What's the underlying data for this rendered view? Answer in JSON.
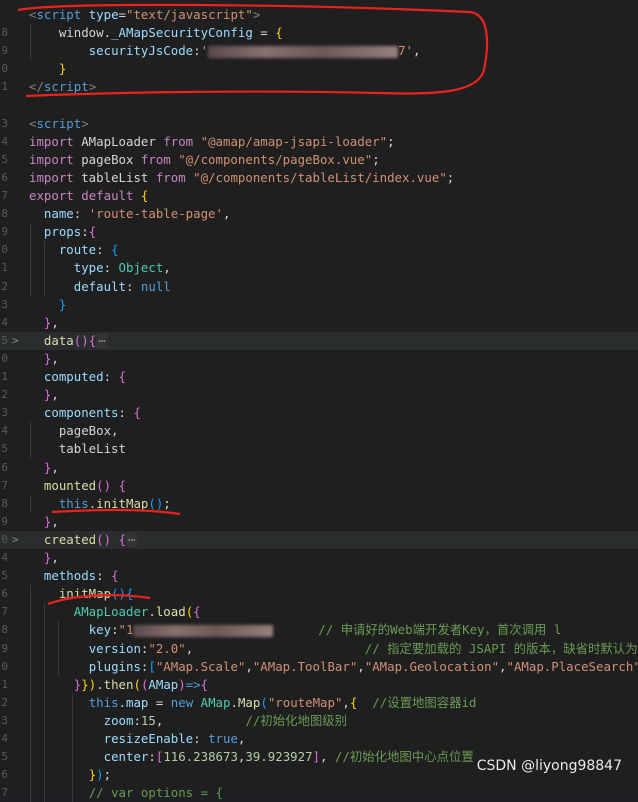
{
  "editor": {
    "language": "vue",
    "lines": [
      {
        "num": "",
        "fold": "",
        "segments": [
          [
            "tag",
            "<"
          ],
          [
            "tagname",
            "script"
          ],
          [
            "attr",
            " type"
          ],
          [
            "plain",
            "="
          ],
          [
            "str",
            "\"text/javascript\""
          ],
          [
            "tag",
            ">"
          ]
        ]
      },
      {
        "num": "8",
        "fold": "",
        "segments": [
          [
            "plain",
            "    window.",
            ""
          ],
          [
            "var",
            "_AMapSecurityConfig"
          ],
          [
            "plain",
            " = "
          ],
          [
            "brk",
            "{"
          ]
        ]
      },
      {
        "num": "9",
        "fold": "",
        "segments": [
          [
            "plain",
            "        "
          ],
          [
            "var",
            "securityJsCode"
          ],
          [
            "plain",
            ":"
          ],
          [
            "str",
            "'"
          ],
          [
            "blur",
            ""
          ],
          [
            "str",
            "7'"
          ],
          [
            "plain",
            ","
          ]
        ]
      },
      {
        "num": "0",
        "fold": "",
        "segments": [
          [
            "plain",
            "    "
          ],
          [
            "brk",
            "}"
          ]
        ]
      },
      {
        "num": "1",
        "fold": "",
        "segments": [
          [
            "tag",
            "</"
          ],
          [
            "tagname",
            "script"
          ],
          [
            "tag",
            ">"
          ]
        ]
      },
      {
        "num": "",
        "fold": "",
        "segments": []
      },
      {
        "num": "3",
        "fold": "",
        "segments": [
          [
            "tag",
            "<"
          ],
          [
            "tagname",
            "script"
          ],
          [
            "tag",
            ">"
          ]
        ]
      },
      {
        "num": "4",
        "fold": "",
        "segments": [
          [
            "kw2",
            "import"
          ],
          [
            "plain",
            " AMapLoader "
          ],
          [
            "kw2",
            "from"
          ],
          [
            "plain",
            " "
          ],
          [
            "str",
            "\"@amap/amap-jsapi-loader\""
          ],
          [
            "plain",
            ";"
          ]
        ]
      },
      {
        "num": "5",
        "fold": "",
        "segments": [
          [
            "kw2",
            "import"
          ],
          [
            "plain",
            " pageBox "
          ],
          [
            "kw2",
            "from"
          ],
          [
            "plain",
            " "
          ],
          [
            "str",
            "\"@/components/pageBox.vue\""
          ],
          [
            "plain",
            ";"
          ]
        ]
      },
      {
        "num": "6",
        "fold": "",
        "segments": [
          [
            "kw2",
            "import"
          ],
          [
            "plain",
            " tableList "
          ],
          [
            "kw2",
            "from"
          ],
          [
            "plain",
            " "
          ],
          [
            "str",
            "\"@/components/tableList/index.vue\""
          ],
          [
            "plain",
            ";"
          ]
        ]
      },
      {
        "num": "7",
        "fold": "",
        "segments": [
          [
            "kw2",
            "export"
          ],
          [
            "plain",
            " "
          ],
          [
            "kw2",
            "default"
          ],
          [
            "plain",
            " "
          ],
          [
            "brk",
            "{"
          ]
        ]
      },
      {
        "num": "8",
        "fold": "",
        "segments": [
          [
            "plain",
            "  "
          ],
          [
            "var",
            "name"
          ],
          [
            "plain",
            ": "
          ],
          [
            "str",
            "'route-table-page'"
          ],
          [
            "plain",
            ","
          ]
        ]
      },
      {
        "num": "9",
        "fold": "",
        "segments": [
          [
            "plain",
            "  "
          ],
          [
            "var",
            "props"
          ],
          [
            "plain",
            ":"
          ],
          [
            "brk2",
            "{"
          ]
        ]
      },
      {
        "num": "0",
        "fold": "",
        "segments": [
          [
            "plain",
            "    "
          ],
          [
            "var",
            "route"
          ],
          [
            "plain",
            ": "
          ],
          [
            "brk3",
            "{"
          ]
        ]
      },
      {
        "num": "1",
        "fold": "",
        "segments": [
          [
            "plain",
            "      "
          ],
          [
            "var",
            "type"
          ],
          [
            "plain",
            ": "
          ],
          [
            "cls",
            "Object"
          ],
          [
            "plain",
            ","
          ]
        ]
      },
      {
        "num": "2",
        "fold": "",
        "segments": [
          [
            "plain",
            "      "
          ],
          [
            "var",
            "default"
          ],
          [
            "plain",
            ": "
          ],
          [
            "kw",
            "null"
          ]
        ]
      },
      {
        "num": "3",
        "fold": "",
        "segments": [
          [
            "plain",
            "    "
          ],
          [
            "brk3",
            "}"
          ]
        ]
      },
      {
        "num": "4",
        "fold": "",
        "segments": [
          [
            "plain",
            "  "
          ],
          [
            "brk2",
            "}"
          ],
          [
            "plain",
            ","
          ]
        ]
      },
      {
        "num": "5",
        "fold": ">",
        "hl": true,
        "segments": [
          [
            "plain",
            "  "
          ],
          [
            "fn",
            "data"
          ],
          [
            "brk2",
            "()"
          ],
          [
            "brk2",
            "{"
          ],
          [
            "ellipsis",
            "⋯"
          ]
        ]
      },
      {
        "num": "0",
        "fold": "",
        "segments": [
          [
            "plain",
            "  "
          ],
          [
            "brk2",
            "}"
          ],
          [
            "plain",
            ","
          ]
        ]
      },
      {
        "num": "1",
        "fold": "",
        "segments": [
          [
            "plain",
            "  "
          ],
          [
            "var",
            "computed"
          ],
          [
            "plain",
            ": "
          ],
          [
            "brk2",
            "{"
          ]
        ]
      },
      {
        "num": "2",
        "fold": "",
        "segments": [
          [
            "plain",
            "  "
          ],
          [
            "brk2",
            "}"
          ],
          [
            "plain",
            ","
          ]
        ]
      },
      {
        "num": "3",
        "fold": "",
        "segments": [
          [
            "plain",
            "  "
          ],
          [
            "var",
            "components"
          ],
          [
            "plain",
            ": "
          ],
          [
            "brk2",
            "{"
          ]
        ]
      },
      {
        "num": "4",
        "fold": "",
        "segments": [
          [
            "plain",
            "    pageBox,"
          ]
        ]
      },
      {
        "num": "5",
        "fold": "",
        "segments": [
          [
            "plain",
            "    tableList"
          ]
        ]
      },
      {
        "num": "6",
        "fold": "",
        "segments": [
          [
            "plain",
            "  "
          ],
          [
            "brk2",
            "}"
          ],
          [
            "plain",
            ","
          ]
        ]
      },
      {
        "num": "7",
        "fold": "",
        "segments": [
          [
            "plain",
            "  "
          ],
          [
            "fn",
            "mounted"
          ],
          [
            "brk2",
            "()"
          ],
          [
            "plain",
            " "
          ],
          [
            "brk2",
            "{"
          ]
        ]
      },
      {
        "num": "8",
        "fold": "",
        "segments": [
          [
            "plain",
            "    "
          ],
          [
            "kw",
            "this"
          ],
          [
            "plain",
            "."
          ],
          [
            "fn",
            "initMap"
          ],
          [
            "brk3",
            "()"
          ],
          [
            "plain",
            ";"
          ]
        ]
      },
      {
        "num": "9",
        "fold": "",
        "segments": [
          [
            "plain",
            "  "
          ],
          [
            "brk2",
            "}"
          ],
          [
            "plain",
            ","
          ]
        ]
      },
      {
        "num": "0",
        "fold": ">",
        "hl": true,
        "segments": [
          [
            "plain",
            "  "
          ],
          [
            "fn",
            "created"
          ],
          [
            "brk2",
            "()"
          ],
          [
            "plain",
            " "
          ],
          [
            "brk2",
            "{"
          ],
          [
            "ellipsis",
            "⋯"
          ]
        ]
      },
      {
        "num": "4",
        "fold": "",
        "segments": [
          [
            "plain",
            "  "
          ],
          [
            "brk2",
            "}"
          ],
          [
            "plain",
            ","
          ]
        ]
      },
      {
        "num": "5",
        "fold": "",
        "segments": [
          [
            "plain",
            "  "
          ],
          [
            "var",
            "methods"
          ],
          [
            "plain",
            ": "
          ],
          [
            "brk2",
            "{"
          ]
        ]
      },
      {
        "num": "6",
        "fold": "",
        "segments": [
          [
            "plain",
            "    "
          ],
          [
            "fn",
            "initMap"
          ],
          [
            "brk3",
            "()"
          ],
          [
            "brk3",
            "{"
          ]
        ]
      },
      {
        "num": "7",
        "fold": "",
        "segments": [
          [
            "plain",
            "      "
          ],
          [
            "cls",
            "AMapLoader"
          ],
          [
            "plain",
            "."
          ],
          [
            "fn",
            "load"
          ],
          [
            "brk",
            "("
          ],
          [
            "brk2",
            "{"
          ]
        ]
      },
      {
        "num": "8",
        "fold": "",
        "segments": [
          [
            "plain",
            "        "
          ],
          [
            "var",
            "key"
          ],
          [
            "plain",
            ":"
          ],
          [
            "str",
            "\"1"
          ],
          [
            "blur",
            ""
          ],
          [
            "plain",
            "      "
          ],
          [
            "cmt",
            "// 申请好的Web端开发者Key，首次调用 l"
          ]
        ]
      },
      {
        "num": "9",
        "fold": "",
        "segments": [
          [
            "plain",
            "        "
          ],
          [
            "var",
            "version"
          ],
          [
            "plain",
            ":"
          ],
          [
            "str",
            "\"2.0\""
          ],
          [
            "plain",
            ",                       "
          ],
          [
            "cmt",
            "// 指定要加载的 JSAPI 的版本，缺省时默认为"
          ]
        ]
      },
      {
        "num": "0",
        "fold": "",
        "segments": [
          [
            "plain",
            "        "
          ],
          [
            "var",
            "plugins"
          ],
          [
            "plain",
            ":"
          ],
          [
            "brk3",
            "["
          ],
          [
            "str",
            "\"AMap.Scale\""
          ],
          [
            "plain",
            ","
          ],
          [
            "str",
            "\"AMap.ToolBar\""
          ],
          [
            "plain",
            ","
          ],
          [
            "str",
            "\"AMap.Geolocation\""
          ],
          [
            "plain",
            ","
          ],
          [
            "str",
            "\"AMap.PlaceSearch\""
          ],
          [
            "brk3",
            "]"
          ],
          [
            "plain",
            ","
          ]
        ]
      },
      {
        "num": "1",
        "fold": "",
        "segments": [
          [
            "plain",
            "      "
          ],
          [
            "brk2",
            "}"
          ],
          [
            "brk",
            "})"
          ],
          [
            "plain",
            "."
          ],
          [
            "fn",
            "then"
          ],
          [
            "brk",
            "("
          ],
          [
            "brk2",
            "("
          ],
          [
            "var",
            "AMap"
          ],
          [
            "brk2",
            ")"
          ],
          [
            "kw",
            "=>"
          ],
          [
            "brk2",
            "{"
          ]
        ]
      },
      {
        "num": "2",
        "fold": "",
        "segments": [
          [
            "plain",
            "        "
          ],
          [
            "kw",
            "this"
          ],
          [
            "plain",
            "."
          ],
          [
            "var",
            "map"
          ],
          [
            "plain",
            " = "
          ],
          [
            "kw",
            "new"
          ],
          [
            "plain",
            " "
          ],
          [
            "cls",
            "AMap"
          ],
          [
            "plain",
            "."
          ],
          [
            "fn",
            "Map"
          ],
          [
            "brk3",
            "("
          ],
          [
            "str",
            "\"routeMap\""
          ],
          [
            "plain",
            ","
          ],
          [
            "brk",
            "{"
          ],
          [
            "plain",
            "  "
          ],
          [
            "cmt",
            "//设置地图容器id"
          ]
        ]
      },
      {
        "num": "3",
        "fold": "",
        "segments": [
          [
            "plain",
            "          "
          ],
          [
            "var",
            "zoom"
          ],
          [
            "plain",
            ":"
          ],
          [
            "num",
            "15"
          ],
          [
            "plain",
            ",           "
          ],
          [
            "cmt",
            "//初始化地图级别"
          ]
        ]
      },
      {
        "num": "4",
        "fold": "",
        "segments": [
          [
            "plain",
            "          "
          ],
          [
            "var",
            "resizeEnable"
          ],
          [
            "plain",
            ": "
          ],
          [
            "kw",
            "true"
          ],
          [
            "plain",
            ","
          ]
        ]
      },
      {
        "num": "5",
        "fold": "",
        "segments": [
          [
            "plain",
            "          "
          ],
          [
            "var",
            "center"
          ],
          [
            "plain",
            ":"
          ],
          [
            "brk2",
            "["
          ],
          [
            "num",
            "116.238673"
          ],
          [
            "plain",
            ","
          ],
          [
            "num",
            "39.923927"
          ],
          [
            "brk2",
            "]"
          ],
          [
            "plain",
            ", "
          ],
          [
            "cmt",
            "//初始化地图中心点位置"
          ]
        ]
      },
      {
        "num": "6",
        "fold": "",
        "segments": [
          [
            "plain",
            "        "
          ],
          [
            "brk",
            "}"
          ],
          [
            "brk3",
            ")"
          ],
          [
            "plain",
            ";"
          ]
        ]
      },
      {
        "num": "7",
        "fold": "",
        "segments": [
          [
            "plain",
            "        "
          ],
          [
            "cmt",
            "// var options = {"
          ]
        ]
      }
    ]
  },
  "watermark": "CSDN @liyong98847",
  "colors": {
    "annotation": "#e8231c",
    "background": "#1f1f1f"
  }
}
